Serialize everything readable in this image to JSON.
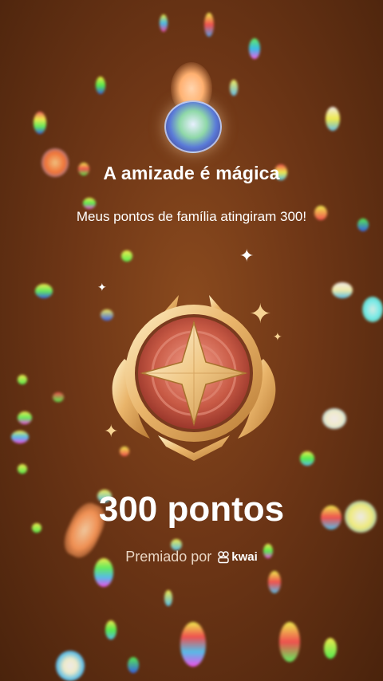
{
  "celebration": {
    "title": "A amizade é mágica",
    "message": "Meus pontos de família atingiram 300!",
    "points_label": "300 pontos",
    "awarded_by": "Premiado por",
    "brand_name": "kwai"
  },
  "icons": {
    "avatar": "avatar-icon",
    "badge": "star-medal-icon",
    "brand": "kwai-logo-icon"
  },
  "colors": {
    "background": "#6e3616",
    "badge_gold": "#e9b46a",
    "badge_red": "#c85a45"
  }
}
